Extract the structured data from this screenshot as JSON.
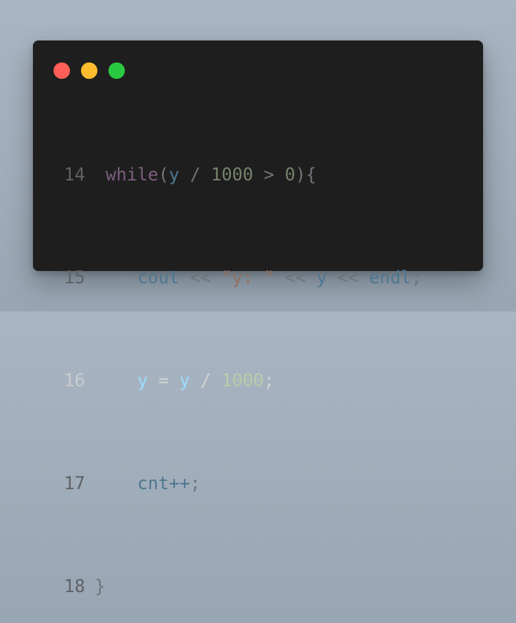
{
  "window": {
    "colors": {
      "background": "#1e1e1e",
      "close": "#ff5f57",
      "minimize": "#febc2e",
      "maximize": "#28c840"
    }
  },
  "code": {
    "lines": [
      {
        "number": "14",
        "tokens": [
          "while",
          "(",
          "y",
          " / ",
          "1000",
          " > ",
          "0",
          "){"
        ]
      },
      {
        "number": "15",
        "tokens": [
          "   ",
          "cout",
          " << ",
          "\"y: \"",
          " << ",
          "y",
          " << ",
          "endl",
          ";"
        ]
      },
      {
        "number": "16",
        "tokens": [
          "   ",
          "y",
          " = ",
          "y",
          " / ",
          "1000",
          ";"
        ]
      },
      {
        "number": "17",
        "tokens": [
          "   ",
          "cnt++",
          ";"
        ]
      },
      {
        "number": "18",
        "tokens": [
          "}"
        ]
      }
    ],
    "active_line": "16"
  }
}
